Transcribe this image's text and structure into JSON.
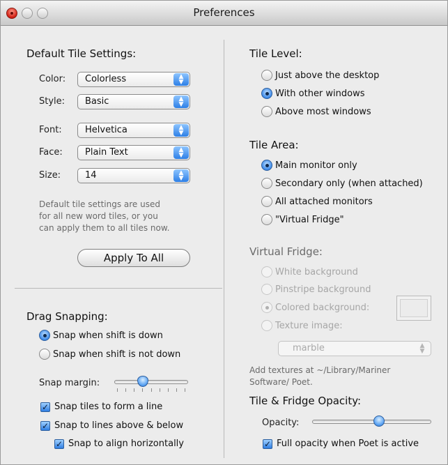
{
  "window": {
    "title": "Preferences"
  },
  "left": {
    "default_tile_settings": {
      "heading": "Default Tile Settings:",
      "color": {
        "label": "Color:",
        "value": "Colorless"
      },
      "style": {
        "label": "Style:",
        "value": "Basic"
      },
      "font": {
        "label": "Font:",
        "value": "Helvetica"
      },
      "face": {
        "label": "Face:",
        "value": "Plain Text"
      },
      "size": {
        "label": "Size:",
        "value": "14"
      },
      "hint_lines": [
        "Default tile settings are used",
        "for all new word tiles, or you",
        "can apply them to all tiles now."
      ],
      "apply_button": "Apply To All"
    },
    "drag_snapping": {
      "heading": "Drag Snapping:",
      "radio_shift_down": "Snap when shift is down",
      "radio_shift_not_down": "Snap when shift is not down",
      "snap_margin_label": "Snap margin:",
      "snap_margin_value": 0.38,
      "check_form_line": "Snap tiles to form a line",
      "check_lines_above_below": "Snap to lines above & below",
      "check_align_horizontally": "Snap to align horizontally"
    }
  },
  "right": {
    "tile_level": {
      "heading": "Tile Level:",
      "option_above_desktop": "Just above the desktop",
      "option_with_windows": "With other windows",
      "option_above_most": "Above most windows"
    },
    "tile_area": {
      "heading": "Tile Area:",
      "option_main_monitor": "Main monitor only",
      "option_secondary": "Secondary only (when attached)",
      "option_all_monitors": "All attached monitors",
      "option_virtual_fridge": "\"Virtual Fridge\""
    },
    "virtual_fridge": {
      "heading": "Virtual Fridge:",
      "option_white": "White background",
      "option_pinstripe": "Pinstripe background",
      "option_colored": "Colored background:",
      "option_texture": "Texture image:",
      "texture_value": "marble",
      "hint_lines": [
        "Add textures at ~/Library/Mariner",
        "Software/ Poet."
      ]
    },
    "opacity": {
      "heading": "Tile & Fridge Opacity:",
      "label": "Opacity:",
      "value": 0.55,
      "check_full_opacity": "Full opacity when Poet is active"
    }
  },
  "colors": {
    "accent": "#3d89e8",
    "disabled_text": "#a6a6a6"
  },
  "icons": {
    "close": "close-icon",
    "minimize": "minimize-icon",
    "zoom": "zoom-icon",
    "popup_arrows": "updown-arrows-icon",
    "check": "checkmark-icon"
  }
}
